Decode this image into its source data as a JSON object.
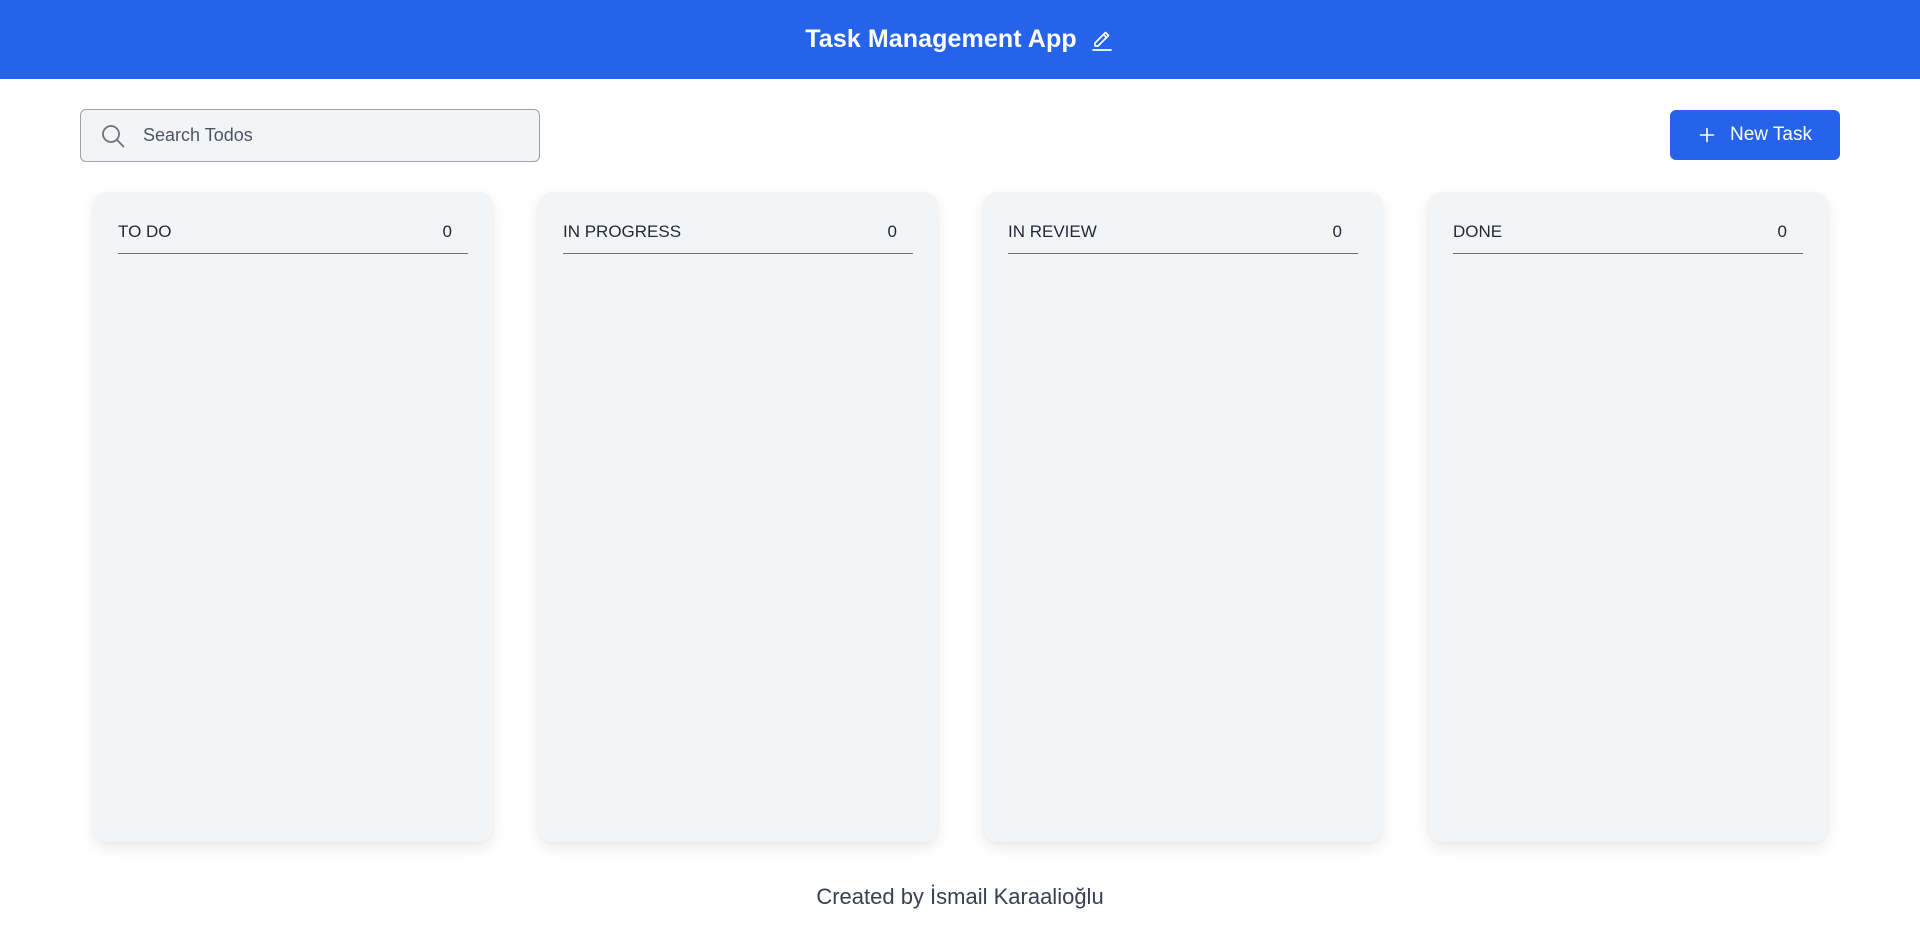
{
  "header": {
    "title": "Task Management App",
    "icon": "pencil-icon",
    "background": "#2563eb"
  },
  "search": {
    "placeholder": "Search Todos",
    "value": "",
    "icon": "search-icon"
  },
  "toolbar": {
    "new_task_label": "New Task",
    "new_task_icon": "plus-icon",
    "accent": "#2563eb"
  },
  "columns": [
    {
      "title": "TO DO",
      "count": "0"
    },
    {
      "title": "IN PROGRESS",
      "count": "0"
    },
    {
      "title": "IN REVIEW",
      "count": "0"
    },
    {
      "title": "DONE",
      "count": "0"
    }
  ],
  "footer": {
    "credit": "Created by İsmail Karaalioğlu"
  }
}
